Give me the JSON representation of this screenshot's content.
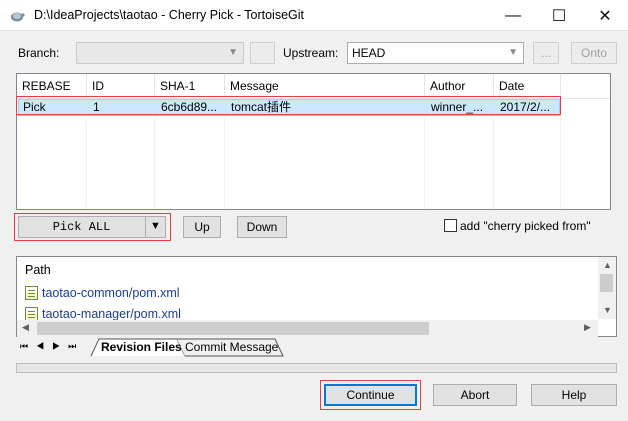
{
  "window": {
    "title": "D:\\IdeaProjects\\taotao - Cherry Pick - TortoiseGit",
    "minimize": "—",
    "maximize": "☐",
    "close": "✕"
  },
  "branch": {
    "label": "Branch:",
    "value": "",
    "extra_button": ""
  },
  "upstream": {
    "label": "Upstream:",
    "value": "HEAD",
    "browse_button": "...",
    "onto_button": "Onto"
  },
  "grid": {
    "columns": [
      "REBASE",
      "ID",
      "SHA-1",
      "Message",
      "Author",
      "Date"
    ],
    "rows": [
      {
        "rebase": "Pick",
        "id": "1",
        "sha": "6cb6d89...",
        "message": "tomcat插件",
        "author": "winner_...",
        "date": "2017/2/..."
      }
    ]
  },
  "actions": {
    "pick_all": "Pick ALL",
    "up": "Up",
    "down": "Down",
    "add_cherry": "add \"cherry picked from\""
  },
  "files": {
    "header": "Path",
    "items": [
      "taotao-common/pom.xml",
      "taotao-manager/pom.xml"
    ]
  },
  "tabs": {
    "revision_files": "Revision Files",
    "commit_message": "Commit Message"
  },
  "buttons": {
    "continue": "Continue",
    "abort": "Abort",
    "help": "Help"
  }
}
